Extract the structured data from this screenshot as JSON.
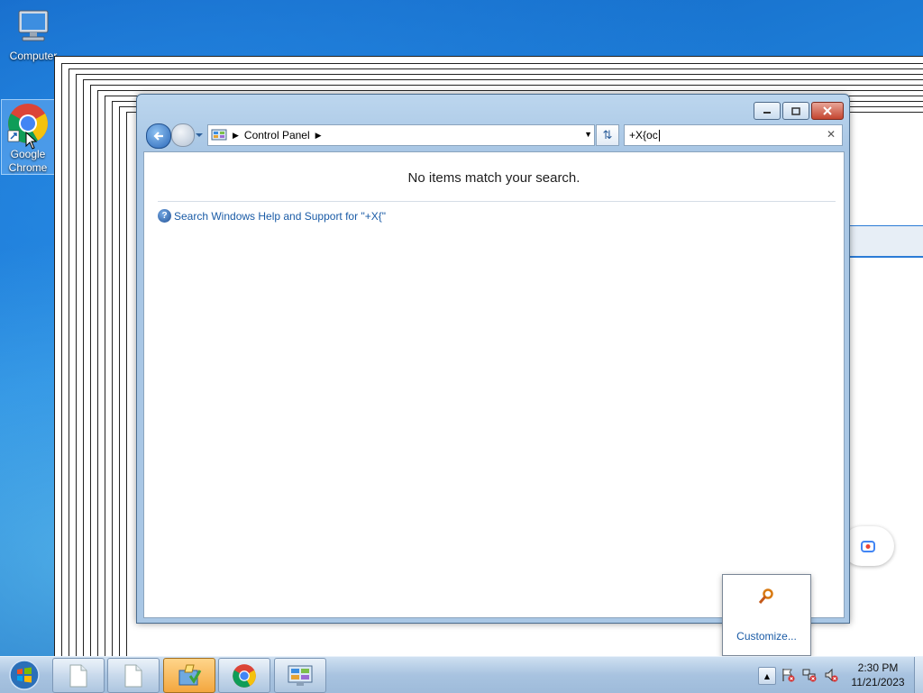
{
  "desktop": {
    "icons": [
      {
        "label": "Computer"
      },
      {
        "label": "Google Chrome"
      }
    ]
  },
  "window": {
    "address": {
      "crumb": "Control Panel"
    },
    "search": {
      "value": "+X{oc"
    },
    "content": {
      "message": "No items match your search.",
      "help_link": "Search Windows Help and Support for \"+X{\""
    }
  },
  "tray_popup": {
    "customize": "Customize..."
  },
  "taskbar": {
    "buttons": [
      {
        "icon": "blank-document-icon"
      },
      {
        "icon": "blank-document-icon"
      },
      {
        "icon": "app-installer-icon",
        "active": true
      },
      {
        "icon": "chrome-icon"
      },
      {
        "icon": "control-panel-icon"
      }
    ],
    "clock": {
      "time": "2:30 PM",
      "date": "11/21/2023"
    }
  },
  "colors": {
    "link": "#1a5ba6",
    "accent": "#2b7bd6",
    "close": "#c4452f"
  }
}
